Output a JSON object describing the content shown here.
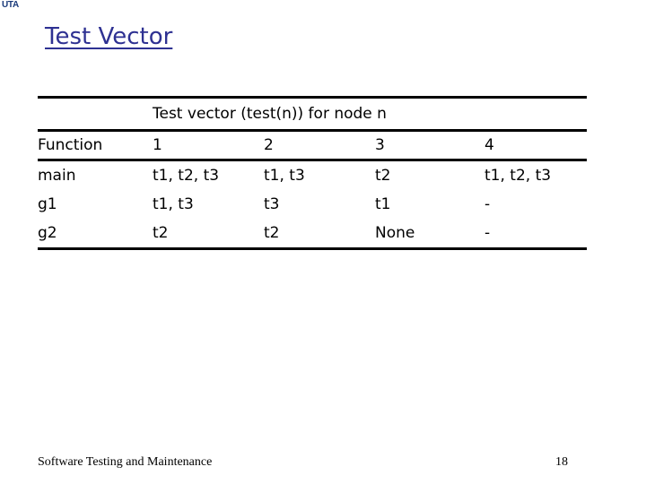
{
  "logo": "UTA",
  "slide": {
    "title": "Test Vector"
  },
  "table": {
    "caption": "Test vector (test(n)) for node n",
    "columns": [
      "Function",
      "1",
      "2",
      "3",
      "4"
    ],
    "rows": [
      [
        "main",
        "t1, t2, t3",
        "t1, t3",
        "t2",
        "t1, t2, t3"
      ],
      [
        "g1",
        "t1, t3",
        "t3",
        "t1",
        "-"
      ],
      [
        "g2",
        "t2",
        "t2",
        "None",
        "-"
      ]
    ]
  },
  "footer": {
    "course": "Software Testing and Maintenance",
    "page_number": "18"
  }
}
